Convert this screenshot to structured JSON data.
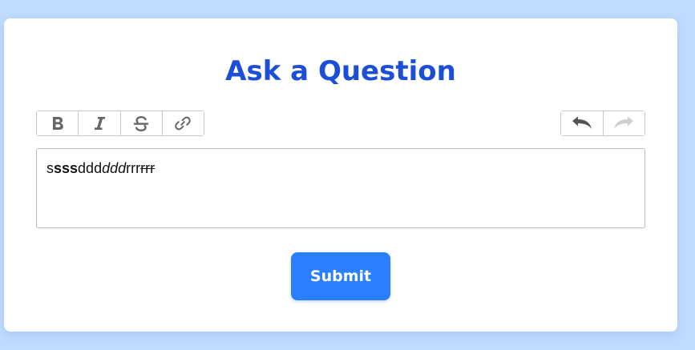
{
  "page": {
    "title": "Ask a Question"
  },
  "toolbar": {
    "format_buttons": [
      {
        "name": "bold-icon"
      },
      {
        "name": "italic-icon"
      },
      {
        "name": "strikethrough-icon"
      },
      {
        "name": "link-icon"
      }
    ],
    "history_buttons": [
      {
        "name": "undo-icon",
        "enabled": true
      },
      {
        "name": "redo-icon",
        "enabled": false
      }
    ]
  },
  "editor": {
    "segments": [
      {
        "text": "s",
        "style": "normal"
      },
      {
        "text": "sss",
        "style": "bold"
      },
      {
        "text": "ddd",
        "style": "normal"
      },
      {
        "text": "ddd",
        "style": "italic"
      },
      {
        "text": "rrr",
        "style": "normal"
      },
      {
        "text": "rrr",
        "style": "strikethrough"
      }
    ]
  },
  "submit": {
    "label": "Submit"
  },
  "colors": {
    "background": "#bfdbfe",
    "title": "#1d4ed8",
    "submit": "#2b7fff",
    "icon": "#666666",
    "icon_disabled": "#cfcfcf"
  }
}
